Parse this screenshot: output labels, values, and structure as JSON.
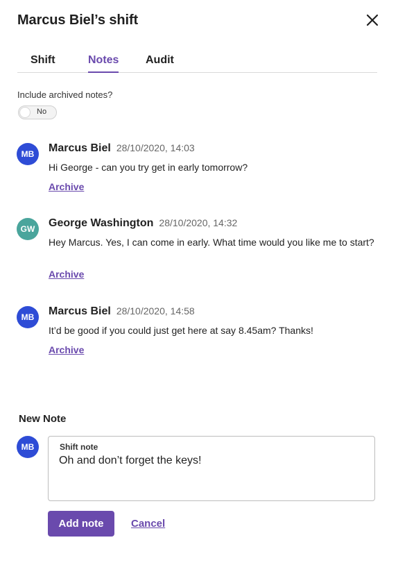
{
  "header": {
    "title": "Marcus Biel’s shift",
    "close_icon": "close-icon"
  },
  "tabs": [
    {
      "label": "Shift",
      "active": false
    },
    {
      "label": "Notes",
      "active": true
    },
    {
      "label": "Audit",
      "active": false
    }
  ],
  "filter": {
    "label": "Include archived notes?",
    "toggle_value": "No"
  },
  "notes": [
    {
      "initials": "MB",
      "avatar_color": "#2e4cd6",
      "author": "Marcus Biel",
      "timestamp": "28/10/2020, 14:03",
      "text": "Hi George - can you try get in early tomorrow?",
      "action": "Archive"
    },
    {
      "initials": "GW",
      "avatar_color": "#4aa59c",
      "author": "George Washington",
      "timestamp": "28/10/2020, 14:32",
      "text": "Hey Marcus. Yes, I can come in early. What time would you like me to start?",
      "action": "Archive"
    },
    {
      "initials": "MB",
      "avatar_color": "#2e4cd6",
      "author": "Marcus Biel",
      "timestamp": "28/10/2020, 14:58",
      "text": "It’d be good if you could just get here at say 8.45am? Thanks!",
      "action": "Archive"
    }
  ],
  "new_note": {
    "heading": "New Note",
    "initials": "MB",
    "field_label": "Shift note",
    "field_value": "Oh and don’t forget the keys!",
    "submit_label": "Add note",
    "cancel_label": "Cancel"
  },
  "colors": {
    "accent": "#6a4aad",
    "avatar_blue": "#2e4cd6",
    "avatar_teal": "#4aa59c"
  }
}
